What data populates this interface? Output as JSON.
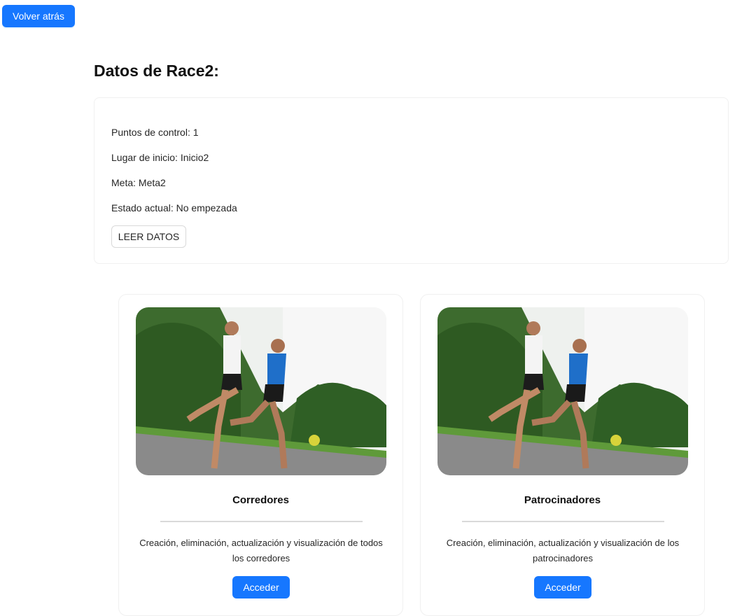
{
  "header": {
    "back_label": "Volver atrás"
  },
  "race": {
    "title": "Datos de Race2:",
    "checkpoints": "Puntos de control: 1",
    "start_place": "Lugar de inicio: Inicio2",
    "finish": "Meta: Meta2",
    "status": "Estado actual: No empezada",
    "read_label": "LEER DATOS"
  },
  "modules": [
    {
      "title": "Corredores",
      "description": "Creación, eliminación, actualización y visualización de todos los corredores",
      "button_label": "Acceder",
      "image_icon": "runners-photo"
    },
    {
      "title": "Patrocinadores",
      "description": "Creación, eliminación, actualización y visualización de los patrocinadores",
      "button_label": "Acceder",
      "image_icon": "runners-photo"
    }
  ],
  "colors": {
    "primary": "#1677ff",
    "border": "#f0f0f0"
  }
}
